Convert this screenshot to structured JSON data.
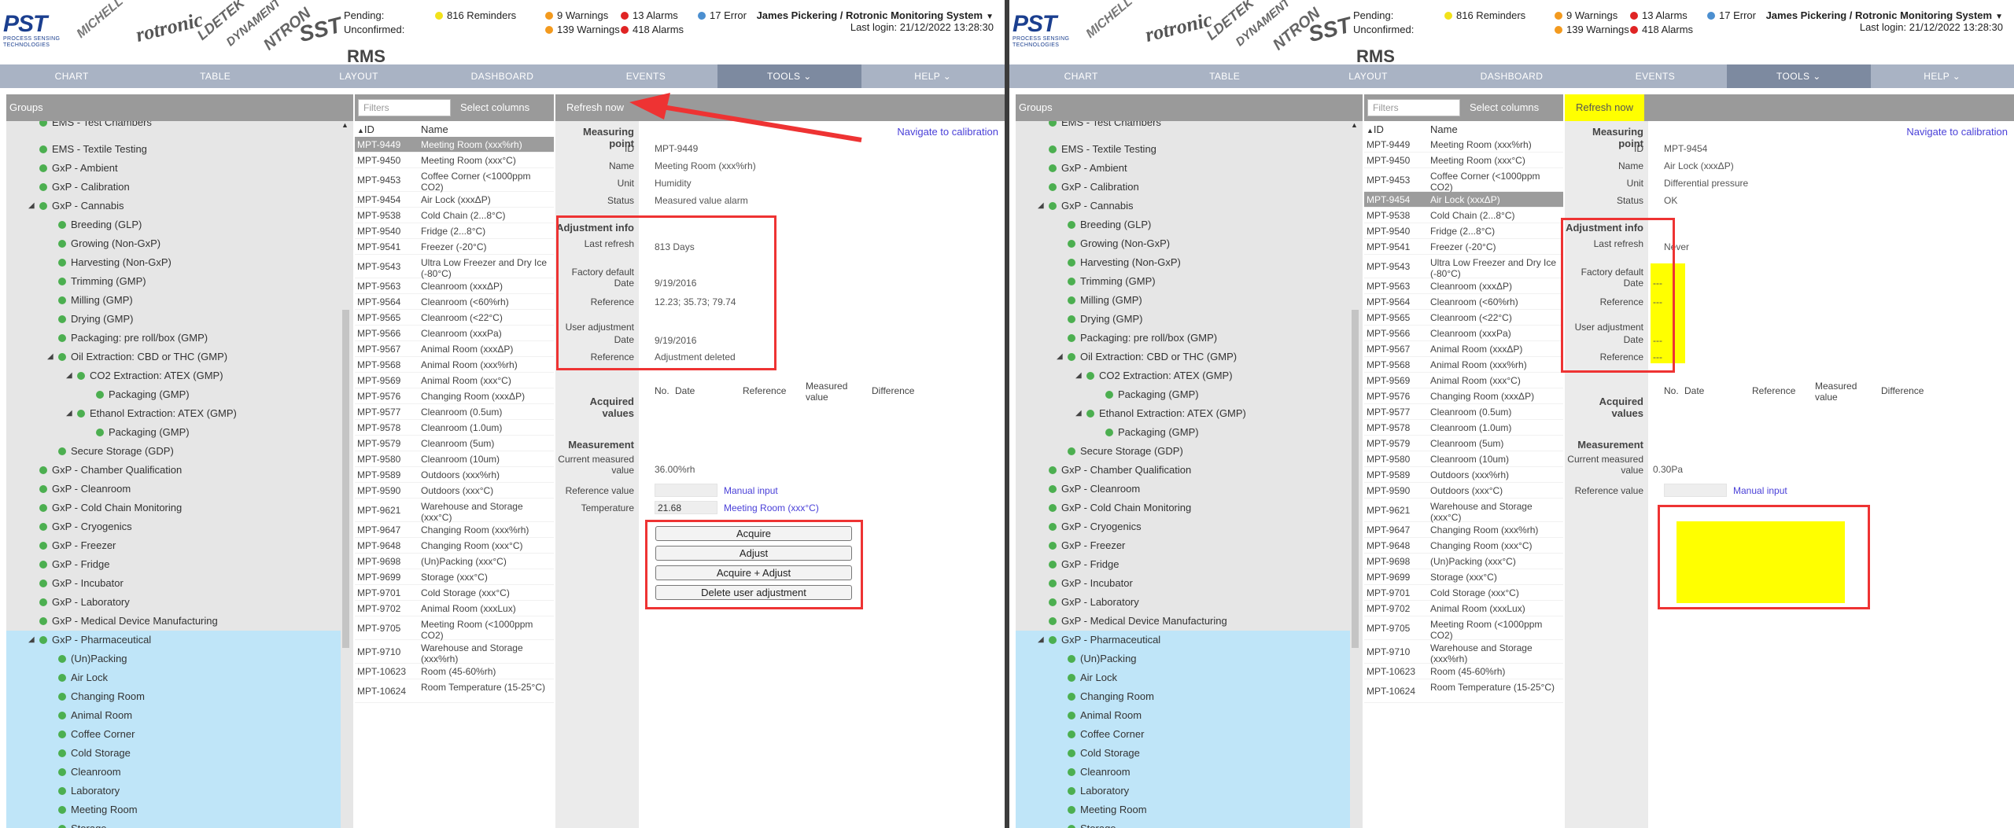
{
  "app": {
    "title": "RMS",
    "brand_pst": "PST",
    "brand_pst_sub": "PROCESS SENSING TECHNOLOGIES",
    "brands": [
      "MICHELL",
      "rotronic",
      "LDETEK",
      "DYNAMENT",
      "NTRON",
      "SST"
    ]
  },
  "alerts": {
    "pending_label": "Pending:",
    "unconfirmed_label": "Unconfirmed:",
    "reminders": "816 Reminders",
    "warnings_pending": "9 Warnings",
    "alarms_pending": "13 Alarms",
    "errors": "17 Error",
    "warnings_unconfirmed": "139 Warnings",
    "alarms_unconfirmed": "418 Alarms",
    "colors": {
      "reminder": "#f2e21a",
      "warning": "#f39a1e",
      "alarm": "#e02424",
      "error": "#4b8fd0"
    }
  },
  "user": {
    "name": "James Pickering / Rotronic Monitoring System",
    "last_login": "Last login: 21/12/2022 13:28:30"
  },
  "nav": {
    "tabs": [
      "CHART",
      "TABLE",
      "LAYOUT",
      "DASHBOARD",
      "EVENTS",
      "TOOLS",
      "HELP"
    ]
  },
  "groups": {
    "header": "Groups",
    "items": [
      {
        "label": "EMS - Test Chambers",
        "level": 1
      },
      {
        "label": "EMS - Textile Testing",
        "level": 1
      },
      {
        "label": "GxP - Ambient",
        "level": 1
      },
      {
        "label": "GxP - Calibration",
        "level": 1
      },
      {
        "label": "GxP - Cannabis",
        "level": 1,
        "expanded": true
      },
      {
        "label": "Breeding (GLP)",
        "level": 2
      },
      {
        "label": "Growing (Non-GxP)",
        "level": 2
      },
      {
        "label": "Harvesting (Non-GxP)",
        "level": 2
      },
      {
        "label": "Trimming (GMP)",
        "level": 2
      },
      {
        "label": "Milling (GMP)",
        "level": 2
      },
      {
        "label": "Drying (GMP)",
        "level": 2
      },
      {
        "label": "Packaging: pre roll/box (GMP)",
        "level": 2
      },
      {
        "label": "Oil Extraction: CBD or THC (GMP)",
        "level": 2,
        "expanded": true
      },
      {
        "label": "CO2 Extraction: ATEX (GMP)",
        "level": 3,
        "expanded": true
      },
      {
        "label": "Packaging (GMP)",
        "level": 4
      },
      {
        "label": "Ethanol Extraction: ATEX (GMP)",
        "level": 3,
        "expanded": true
      },
      {
        "label": "Packaging (GMP)",
        "level": 4
      },
      {
        "label": "Secure Storage (GDP)",
        "level": 2
      },
      {
        "label": "GxP - Chamber Qualification",
        "level": 1
      },
      {
        "label": "GxP - Cleanroom",
        "level": 1
      },
      {
        "label": "GxP - Cold Chain Monitoring",
        "level": 1
      },
      {
        "label": "GxP - Cryogenics",
        "level": 1
      },
      {
        "label": "GxP - Freezer",
        "level": 1
      },
      {
        "label": "GxP - Fridge",
        "level": 1
      },
      {
        "label": "GxP - Incubator",
        "level": 1
      },
      {
        "label": "GxP - Laboratory",
        "level": 1
      },
      {
        "label": "GxP - Medical Device Manufacturing",
        "level": 1
      },
      {
        "label": "GxP - Pharmaceutical",
        "level": 1,
        "expanded": true,
        "sel": true
      },
      {
        "label": "(Un)Packing",
        "level": 2,
        "sel": true
      },
      {
        "label": "Air Lock",
        "level": 2,
        "sel": true
      },
      {
        "label": "Changing Room",
        "level": 2,
        "sel": true
      },
      {
        "label": "Animal Room",
        "level": 2,
        "sel": true
      },
      {
        "label": "Coffee Corner",
        "level": 2,
        "sel": true
      },
      {
        "label": "Cold Storage",
        "level": 2,
        "sel": true
      },
      {
        "label": "Cleanroom",
        "level": 2,
        "sel": true
      },
      {
        "label": "Laboratory",
        "level": 2,
        "sel": true
      },
      {
        "label": "Meeting Room",
        "level": 2,
        "sel": true
      },
      {
        "label": "Storage",
        "level": 2,
        "sel": true
      }
    ]
  },
  "list": {
    "filter_placeholder": "Filters",
    "select_columns": "Select columns",
    "col_id": "ID",
    "col_name": "Name",
    "rows": [
      {
        "id": "MPT-9449",
        "name": "Meeting Room (xxx%rh)",
        "lines": 1
      },
      {
        "id": "MPT-9450",
        "name": "Meeting Room (xxx°C)",
        "lines": 1
      },
      {
        "id": "MPT-9453",
        "name": "Coffee Corner (<1000ppm CO2)",
        "lines": 2
      },
      {
        "id": "MPT-9454",
        "name": "Air Lock (xxxΔP)",
        "lines": 1
      },
      {
        "id": "MPT-9538",
        "name": "Cold Chain (2...8°C)",
        "lines": 1
      },
      {
        "id": "MPT-9540",
        "name": "Fridge (2...8°C)",
        "lines": 1
      },
      {
        "id": "MPT-9541",
        "name": "Freezer (-20°C)",
        "lines": 1
      },
      {
        "id": "MPT-9543",
        "name": "Ultra Low Freezer and Dry Ice (-80°C)",
        "lines": 2
      },
      {
        "id": "MPT-9563",
        "name": "Cleanroom (xxxΔP)",
        "lines": 1
      },
      {
        "id": "MPT-9564",
        "name": "Cleanroom (<60%rh)",
        "lines": 1
      },
      {
        "id": "MPT-9565",
        "name": "Cleanroom (<22°C)",
        "lines": 1
      },
      {
        "id": "MPT-9566",
        "name": "Cleanroom (xxxPa)",
        "lines": 1
      },
      {
        "id": "MPT-9567",
        "name": "Animal Room (xxxΔP)",
        "lines": 1
      },
      {
        "id": "MPT-9568",
        "name": "Animal Room (xxx%rh)",
        "lines": 1
      },
      {
        "id": "MPT-9569",
        "name": "Animal Room (xxx°C)",
        "lines": 1
      },
      {
        "id": "MPT-9576",
        "name": "Changing Room (xxxΔP)",
        "lines": 1
      },
      {
        "id": "MPT-9577",
        "name": "Cleanroom (0.5um)",
        "lines": 1
      },
      {
        "id": "MPT-9578",
        "name": "Cleanroom (1.0um)",
        "lines": 1
      },
      {
        "id": "MPT-9579",
        "name": "Cleanroom (5um)",
        "lines": 1
      },
      {
        "id": "MPT-9580",
        "name": "Cleanroom (10um)",
        "lines": 1
      },
      {
        "id": "MPT-9589",
        "name": "Outdoors (xxx%rh)",
        "lines": 1
      },
      {
        "id": "MPT-9590",
        "name": "Outdoors (xxx°C)",
        "lines": 1
      },
      {
        "id": "MPT-9621",
        "name": "Warehouse and Storage (xxx°C)",
        "lines": 2
      },
      {
        "id": "MPT-9647",
        "name": "Changing Room (xxx%rh)",
        "lines": 1
      },
      {
        "id": "MPT-9648",
        "name": "Changing Room (xxx°C)",
        "lines": 1
      },
      {
        "id": "MPT-9698",
        "name": "(Un)Packing (xxx°C)",
        "lines": 1
      },
      {
        "id": "MPT-9699",
        "name": "Storage (xxx°C)",
        "lines": 1
      },
      {
        "id": "MPT-9701",
        "name": "Cold Storage (xxx°C)",
        "lines": 1
      },
      {
        "id": "MPT-9702",
        "name": "Animal Room (xxxLux)",
        "lines": 1
      },
      {
        "id": "MPT-9705",
        "name": "Meeting Room (<1000ppm CO2)",
        "lines": 2
      },
      {
        "id": "MPT-9710",
        "name": "Warehouse and Storage (xxx%rh)",
        "lines": 2
      },
      {
        "id": "MPT-10623",
        "name": "Room (45-60%rh)",
        "lines": 1
      },
      {
        "id": "MPT-10624",
        "name": "Room Temperature (15-25°C)",
        "lines": 2
      }
    ]
  },
  "details": {
    "refresh": "Refresh now",
    "navigate": "Navigate to calibration",
    "measuring_point": "Measuring point",
    "labels": {
      "id": "ID",
      "name": "Name",
      "unit": "Unit",
      "status": "Status"
    },
    "adjustment_info": "Adjustment info",
    "last_refresh": "Last refresh",
    "factory_default": "Factory default",
    "date": "Date",
    "reference": "Reference",
    "user_adjustment": "User adjustment",
    "acquired_values": "Acquired values",
    "acq_cols": [
      "No.",
      "Date",
      "Reference",
      "Measured value",
      "Difference"
    ],
    "measurement": "Measurement",
    "current_measured": "Current measured value",
    "reference_value": "Reference value",
    "temperature": "Temperature",
    "manual_input": "Manual input",
    "buttons": {
      "acquire": "Acquire",
      "adjust": "Adjust",
      "acquire_adjust": "Acquire + Adjust",
      "delete": "Delete user adjustment"
    }
  },
  "left": {
    "id": "MPT-9449",
    "name": "Meeting Room (xxx%rh)",
    "unit": "Humidity",
    "status": "Measured value alarm",
    "last_refresh": "813 Days",
    "factory_date": "9/19/2016",
    "factory_reference": "12.23; 35.73; 79.74",
    "user_date": "9/19/2016",
    "user_reference": "Adjustment deleted",
    "current_value": "36.00%rh",
    "reference_value": "",
    "temperature_value": "21.68",
    "temperature_link": "Meeting Room (xxx°C)"
  },
  "right": {
    "id": "MPT-9454",
    "name": "Air Lock (xxxΔP)",
    "unit": "Differential pressure",
    "status": "OK",
    "last_refresh": "Never",
    "factory_date": "---",
    "factory_reference": "---",
    "user_date": "---",
    "user_reference": "---",
    "current_value": "0.30Pa",
    "reference_value": ""
  }
}
